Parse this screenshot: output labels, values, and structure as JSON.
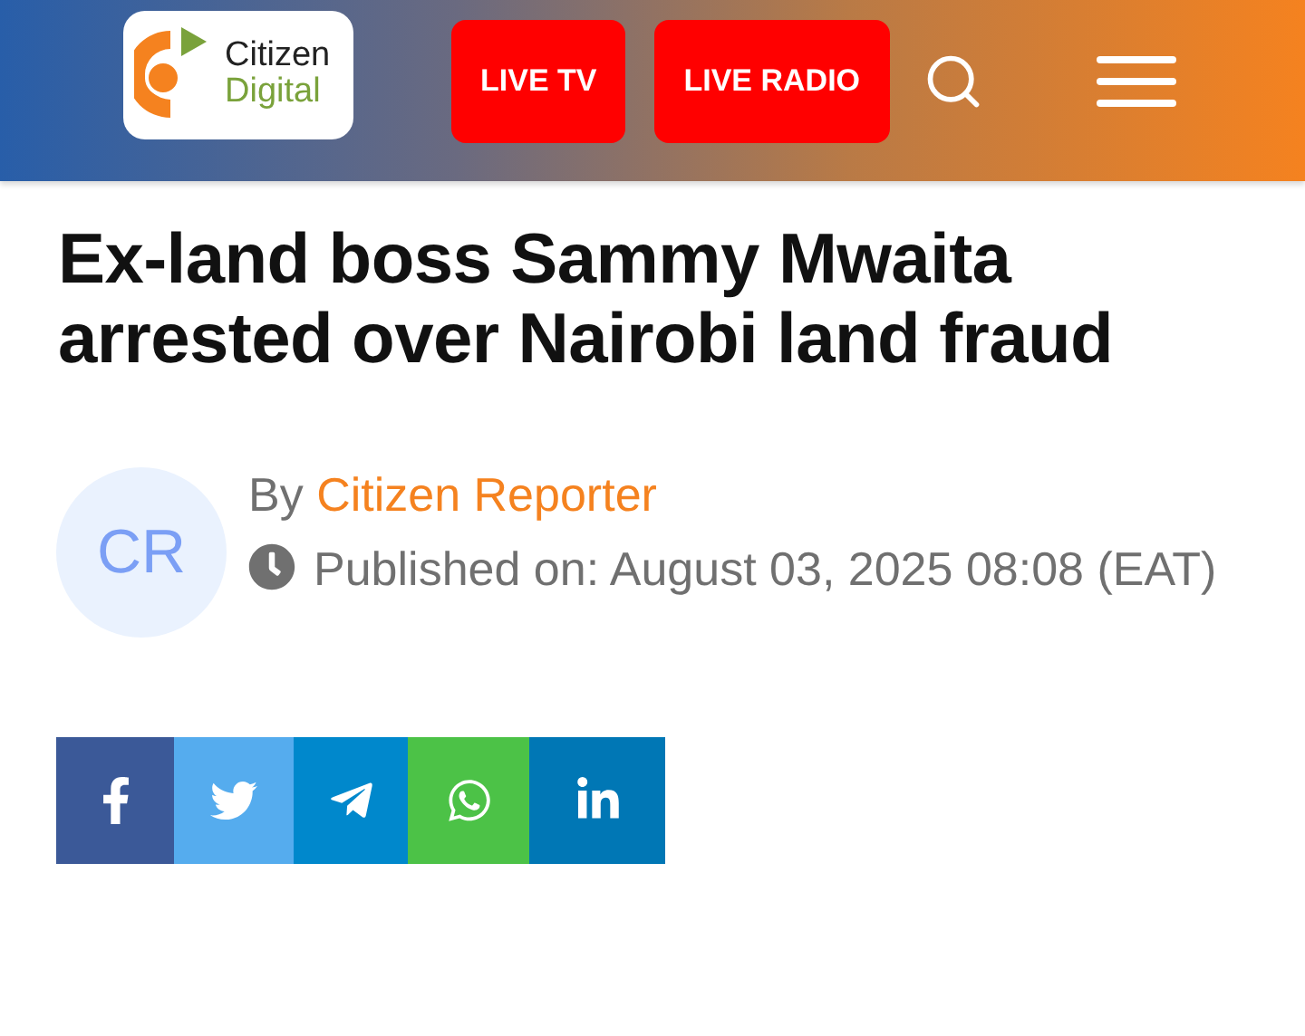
{
  "header": {
    "logo": {
      "line_1": "Citizen",
      "line_2": "Digital"
    },
    "buttons": [
      {
        "label": "LIVE TV"
      },
      {
        "label": "LIVE RADIO"
      }
    ]
  },
  "article": {
    "title": "Ex-land boss Sammy Mwaita arrested over Nairobi land fraud",
    "avatar": "CR",
    "by": "By",
    "author": "Citizen Reporter",
    "published": "Published on: August 03, 2025 08:08 (EAT)"
  },
  "share": [
    {
      "kind": "facebook"
    },
    {
      "kind": "twitter"
    },
    {
      "kind": "telegram"
    },
    {
      "kind": "whatsapp"
    },
    {
      "kind": "linkedin"
    }
  ]
}
